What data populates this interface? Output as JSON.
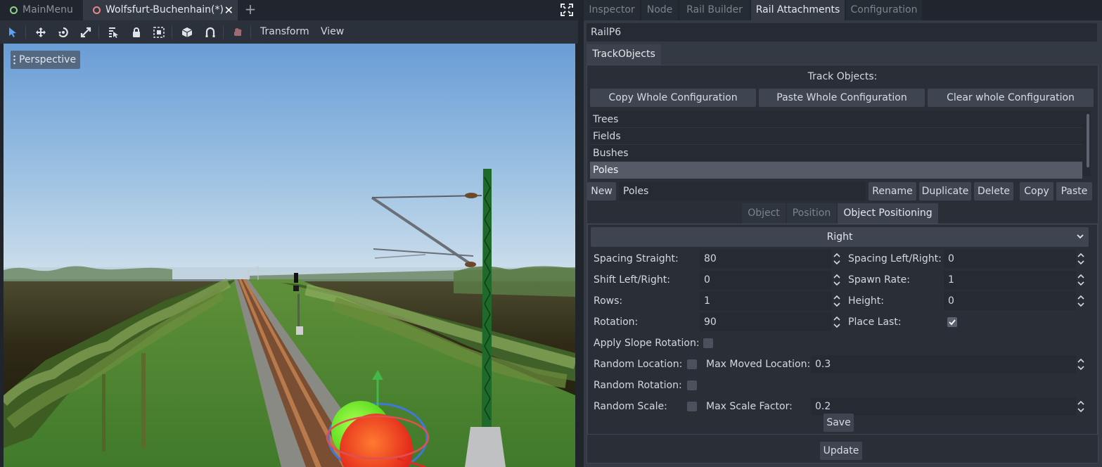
{
  "scene_tabs": [
    {
      "label": "MainMenu"
    },
    {
      "label": "Wolfsfurt-Buchenhain(*)"
    }
  ],
  "toolbar": {
    "menus": [
      "Transform",
      "View"
    ]
  },
  "viewport": {
    "mode_label": "Perspective"
  },
  "dock": {
    "tabs": [
      "Inspector",
      "Node",
      "Rail Builder",
      "Rail Attachments",
      "Configuration"
    ],
    "active_tab": "Rail Attachments",
    "rail_name": "RailP6",
    "sub_tab": "TrackObjects",
    "section_title": "Track Objects:",
    "config_buttons": [
      "Copy Whole Configuration",
      "Paste Whole Configuration",
      "Clear whole Configuration"
    ],
    "objects_list": [
      "Trees",
      "Fields",
      "Bushes",
      "Poles"
    ],
    "selected_object": "Poles",
    "object_row": {
      "new_label": "New",
      "name_value": "Poles",
      "rename_label": "Rename",
      "duplicate_label": "Duplicate",
      "delete_label": "Delete",
      "copy_label": "Copy",
      "paste_label": "Paste"
    },
    "object_tabs": [
      "Object",
      "Position",
      "Object Positioning"
    ],
    "active_object_tab": "Object Positioning",
    "side_select": "Right",
    "params": {
      "spacing_straight_label": "Spacing Straight:",
      "spacing_straight": "80",
      "spacing_lr_label": "Spacing Left/Right:",
      "spacing_lr": "0",
      "shift_lr_label": "Shift Left/Right:",
      "shift_lr": "0",
      "spawn_rate_label": "Spawn Rate:",
      "spawn_rate": "1",
      "rows_label": "Rows:",
      "rows": "1",
      "height_label": "Height:",
      "height": "0",
      "rotation_label": "Rotation:",
      "rotation": "90",
      "place_last_label": "Place Last:",
      "place_last": true,
      "apply_slope_label": "Apply Slope Rotation:",
      "apply_slope": false,
      "random_location_label": "Random Location:",
      "random_location": false,
      "max_moved_label": "Max Moved Location:",
      "max_moved": "0.3",
      "random_rotation_label": "Random Rotation:",
      "random_rotation": false,
      "random_scale_label": "Random Scale:",
      "random_scale": false,
      "max_scale_label": "Max Scale Factor:",
      "max_scale": "0.2"
    },
    "save_label": "Save",
    "update_label": "Update"
  },
  "colors": {
    "accent": "#4d8cd9",
    "panel": "#333a44",
    "field": "#262b33",
    "selected_row": "#5b6270"
  }
}
